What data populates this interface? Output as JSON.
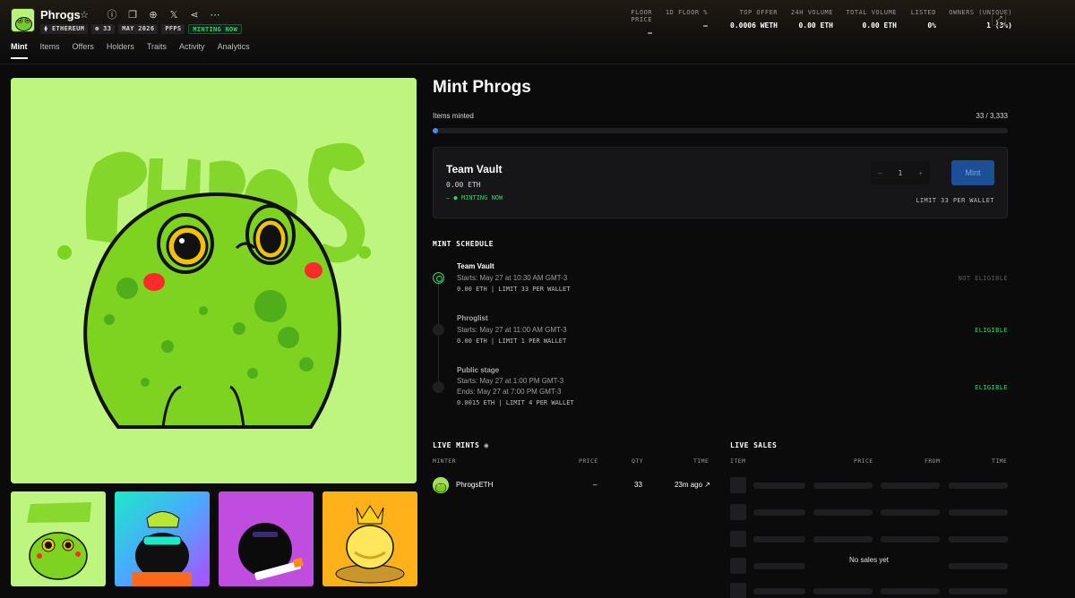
{
  "header": {
    "title": "Phrogs",
    "badges": [
      "⧫ ETHEREUM",
      "⊛ 33",
      "MAY 2026",
      "PFPS",
      "MINTING NOW"
    ],
    "stats": [
      {
        "label": "FLOOR PRICE",
        "value": "–"
      },
      {
        "label": "1D FLOOR %",
        "value": "–"
      },
      {
        "label": "TOP OFFER",
        "value": "0.0006 WETH"
      },
      {
        "label": "24H VOLUME",
        "value": "0.00 ETH"
      },
      {
        "label": "TOTAL VOLUME",
        "value": "0.00 ETH"
      },
      {
        "label": "LISTED",
        "value": "0%"
      },
      {
        "label": "OWNERS (UNIQUE)",
        "value": "1 (3%)"
      }
    ],
    "tabs": [
      "Mint",
      "Items",
      "Offers",
      "Holders",
      "Traits",
      "Activity",
      "Analytics"
    ]
  },
  "mint": {
    "title": "Mint Phrogs",
    "items_minted_label": "Items minted",
    "items_minted_value": "33 / 3,333",
    "progress_fraction": 0.0099,
    "card": {
      "name": "Team Vault",
      "price": "0.00 ETH",
      "status": "–  ● MINTING NOW",
      "stepper_minus": "–",
      "quantity": "1",
      "stepper_plus": "+",
      "button": "Mint",
      "limit": "LIMIT 33 PER WALLET"
    },
    "schedule_title": "MINT SCHEDULE",
    "stages": [
      {
        "name": "Team Vault",
        "start": "Starts: May 27 at 10:30 AM GMT-3",
        "end": "",
        "price": "0.00 ETH | LIMIT 33 PER WALLET",
        "eligibility": "NOT ELIGIBLE"
      },
      {
        "name": "Phroglist",
        "start": "Starts: May 27 at 11:00 AM GMT-3",
        "end": "",
        "price": "0.00 ETH | LIMIT 1 PER WALLET",
        "eligibility": "ELIGIBLE"
      },
      {
        "name": "Public stage",
        "start": "Starts: May 27 at 1:00 PM GMT-3",
        "end": "Ends: May 27 at 7:00 PM GMT-3",
        "price": "0.0015 ETH | LIMIT 4 PER WALLET",
        "eligibility": "ELIGIBLE"
      }
    ]
  },
  "live_mints": {
    "title": "LIVE MINTS",
    "columns": [
      "MINTER",
      "PRICE",
      "QTY",
      "TIME"
    ],
    "rows": [
      {
        "minter": "PhrogsETH",
        "price": "–",
        "qty": "33",
        "time": "23m ago ↗"
      }
    ]
  },
  "live_sales": {
    "title": "LIVE SALES",
    "columns": [
      "ITEM",
      "PRICE",
      "FROM",
      "TIME"
    ],
    "empty": "No sales yet"
  },
  "colors": {
    "accent_green": "#34d36b",
    "mint_button": "#1d4f99",
    "progress": "#3f8cff"
  }
}
